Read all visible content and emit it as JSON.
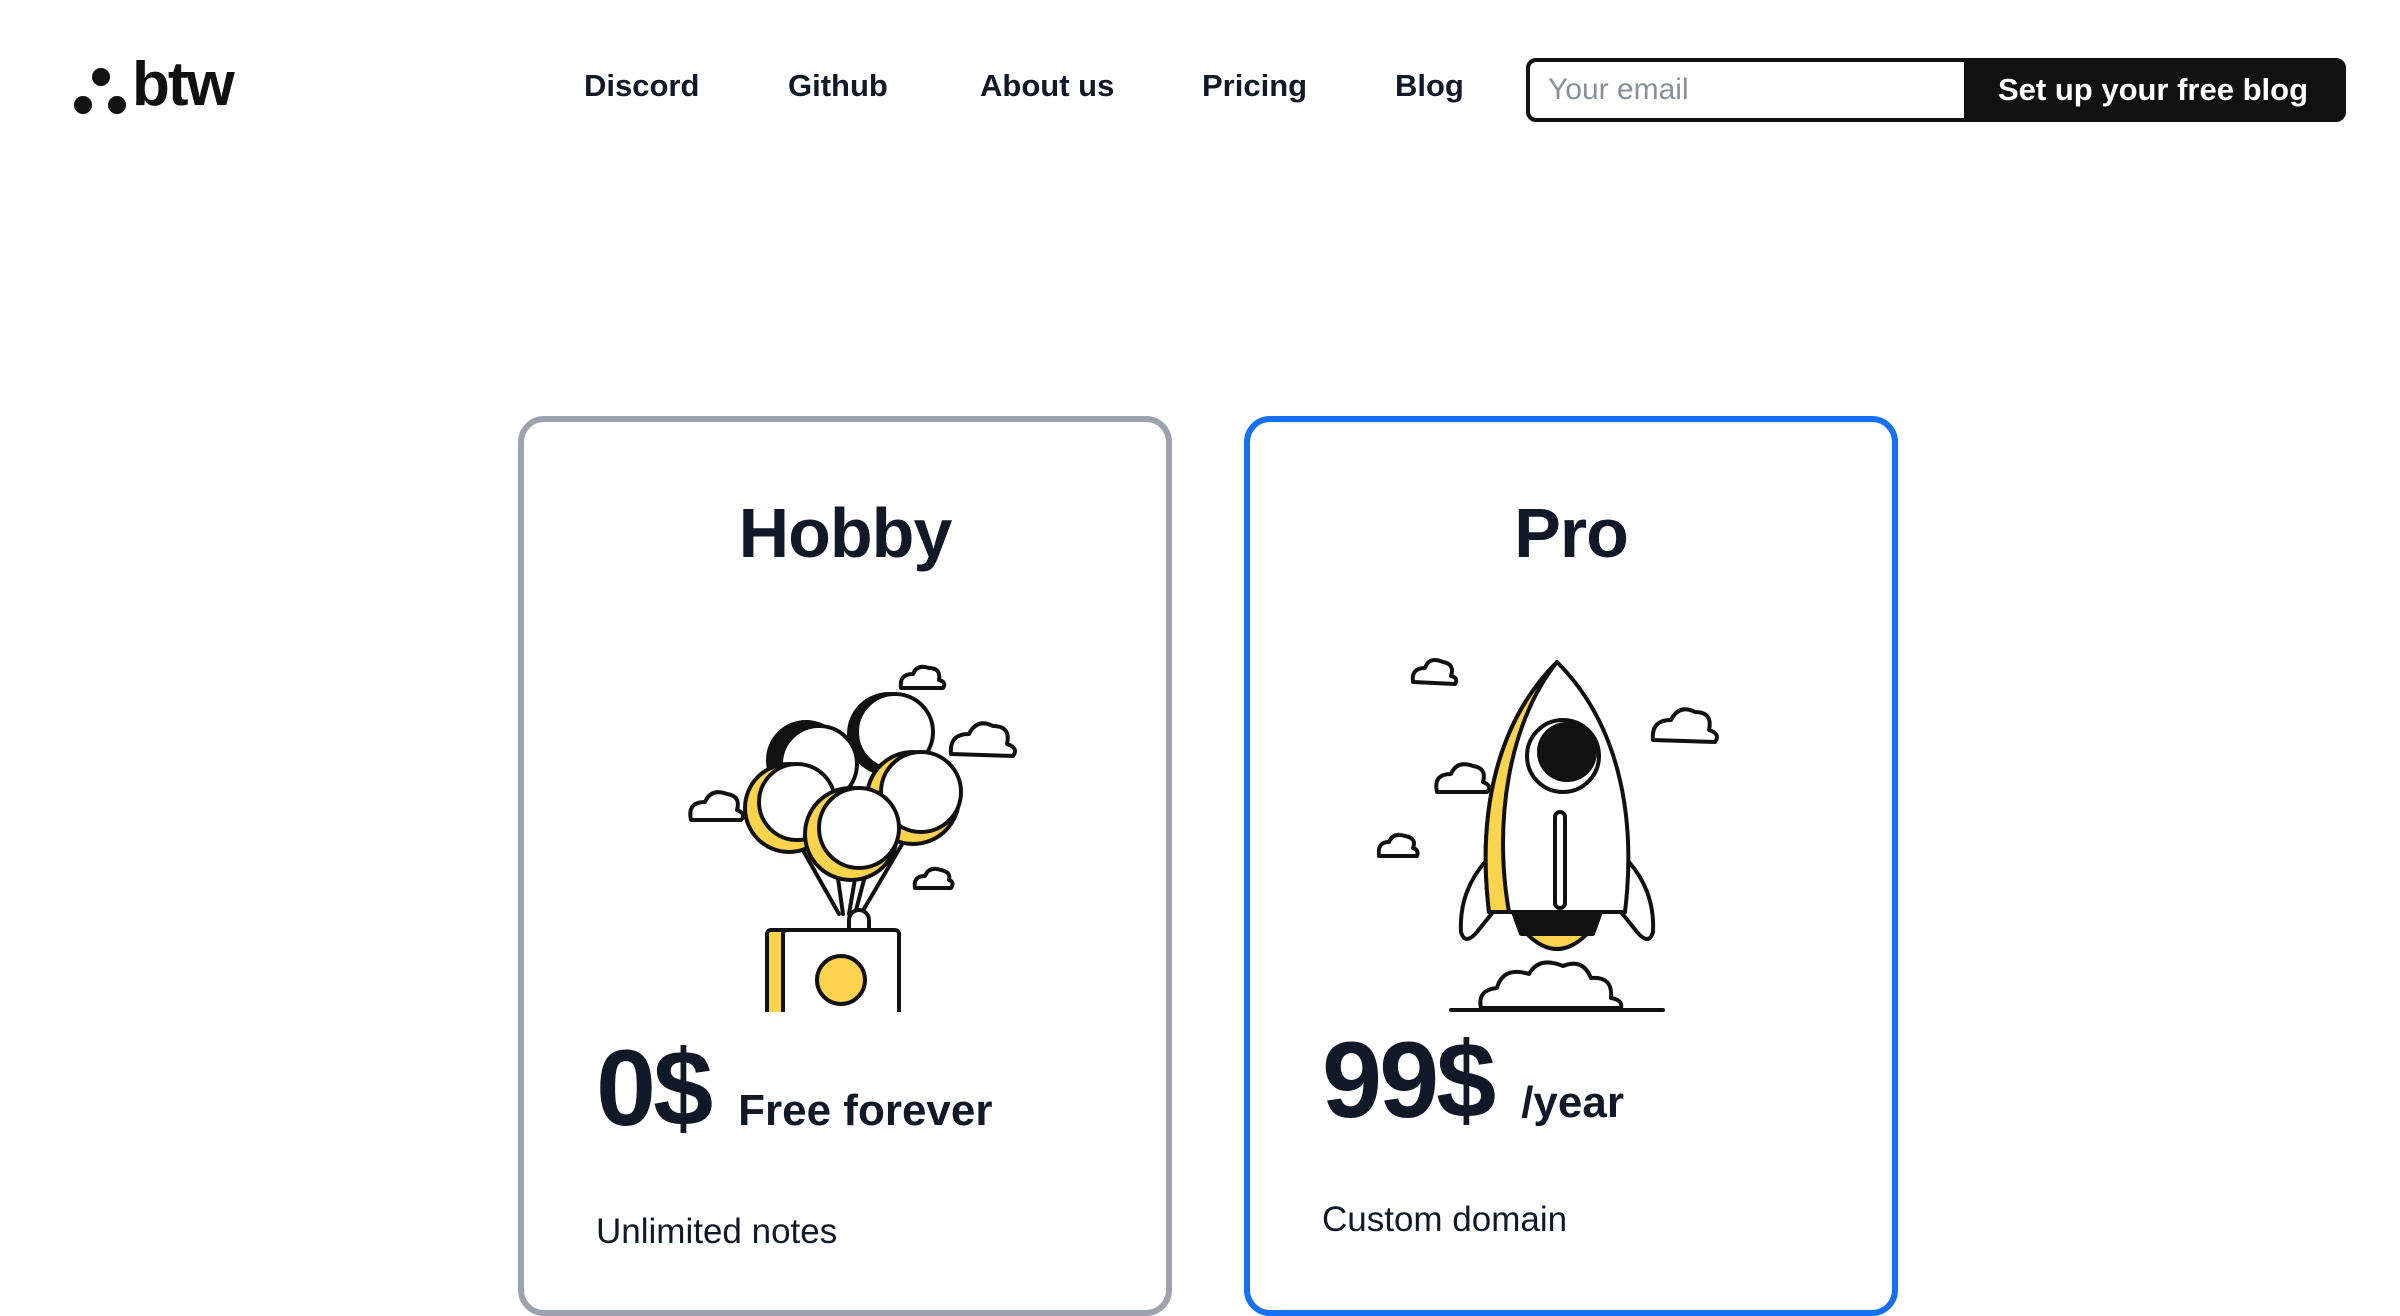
{
  "brand": {
    "name": "btw"
  },
  "nav": {
    "links": [
      {
        "label": "Discord"
      },
      {
        "label": "Github"
      },
      {
        "label": "About us"
      },
      {
        "label": "Pricing"
      },
      {
        "label": "Blog"
      }
    ]
  },
  "signup": {
    "email_placeholder": "Your email",
    "cta_label": "Set up your free blog"
  },
  "plans": [
    {
      "name": "Hobby",
      "illustration": "balloons-box-icon",
      "price": "0$",
      "period": "Free forever",
      "features": [
        "Unlimited notes"
      ],
      "border_color": "#9ca3af"
    },
    {
      "name": "Pro",
      "illustration": "rocket-icon",
      "price": "99$",
      "period": "/year",
      "features": [
        "Custom domain"
      ],
      "border_color": "#1670f7"
    }
  ],
  "colors": {
    "accent_yellow": "#fcd34d",
    "pro_blue": "#1670f7",
    "ink": "#111827"
  }
}
